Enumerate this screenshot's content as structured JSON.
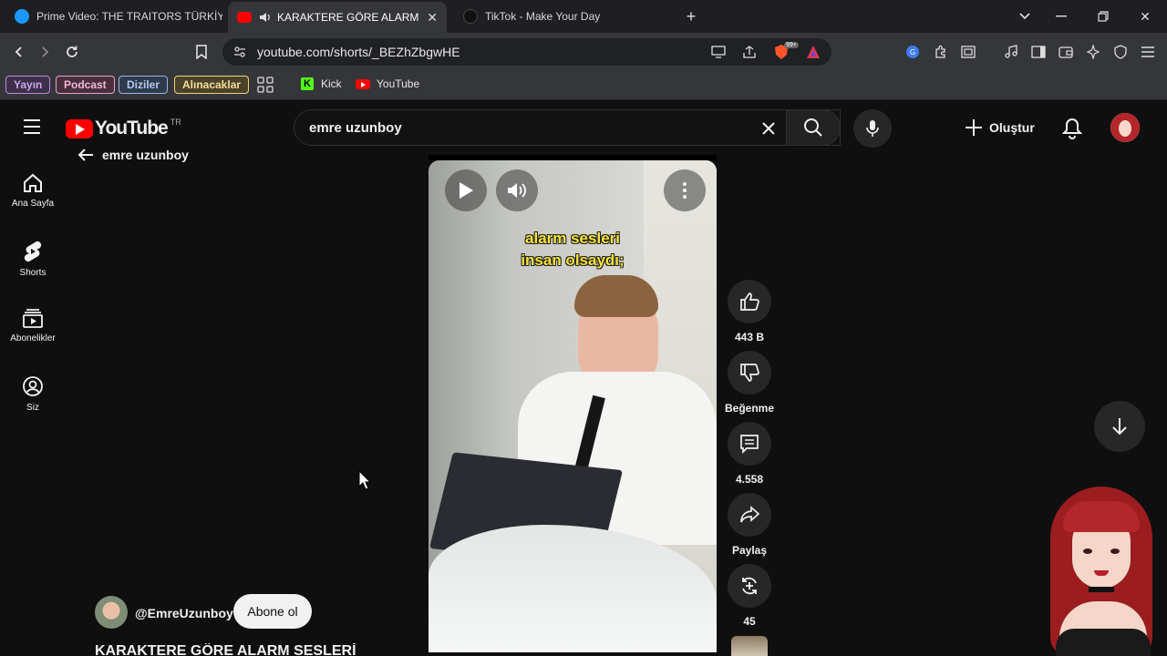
{
  "tabs": [
    {
      "title": "Prime Video: THE TRAITORS TÜRKİYE",
      "active": false
    },
    {
      "title": "KARAKTERE GÖRE ALARM SE",
      "active": true
    },
    {
      "title": "TikTok - Make Your Day",
      "active": false
    }
  ],
  "url": "youtube.com/shorts/_BEZhZbgwHE",
  "bookmarks": {
    "chips": [
      {
        "label": "Yayın",
        "color": "#b98bd8"
      },
      {
        "label": "Podcast",
        "color": "#e7a3c9"
      },
      {
        "label": "Diziler",
        "color": "#9bb5e8"
      },
      {
        "label": "Alınacaklar",
        "color": "#f0d27a"
      }
    ],
    "kick": "Kick",
    "youtube": "YouTube"
  },
  "youtube": {
    "logo_text": "YouTube",
    "region": "TR",
    "back_label": "emre uzunboy",
    "search_value": "emre uzunboy",
    "create_label": "Oluştur",
    "sidebar": [
      {
        "label": "Ana Sayfa",
        "icon": "home-icon"
      },
      {
        "label": "Shorts",
        "icon": "shorts-icon"
      },
      {
        "label": "Abonelikler",
        "icon": "subscriptions-icon"
      },
      {
        "label": "Siz",
        "icon": "you-icon"
      }
    ]
  },
  "video": {
    "caption_line1": "alarm sesleri",
    "caption_line2": "insan olsaydı;",
    "channel": "@EmreUzunboy",
    "subscribe_label": "Abone ol",
    "title_partial": "KARAKTERE GÖRE ALARM SESLERİ"
  },
  "actions": {
    "likes": "443 B",
    "dislike_label": "Beğenme",
    "comments": "4.558",
    "share_label": "Paylaş",
    "remix_count": "45"
  },
  "colors": {
    "accent_red": "#ff0000",
    "caption_yellow": "#f7e33a",
    "kick_green": "#53fc18"
  }
}
